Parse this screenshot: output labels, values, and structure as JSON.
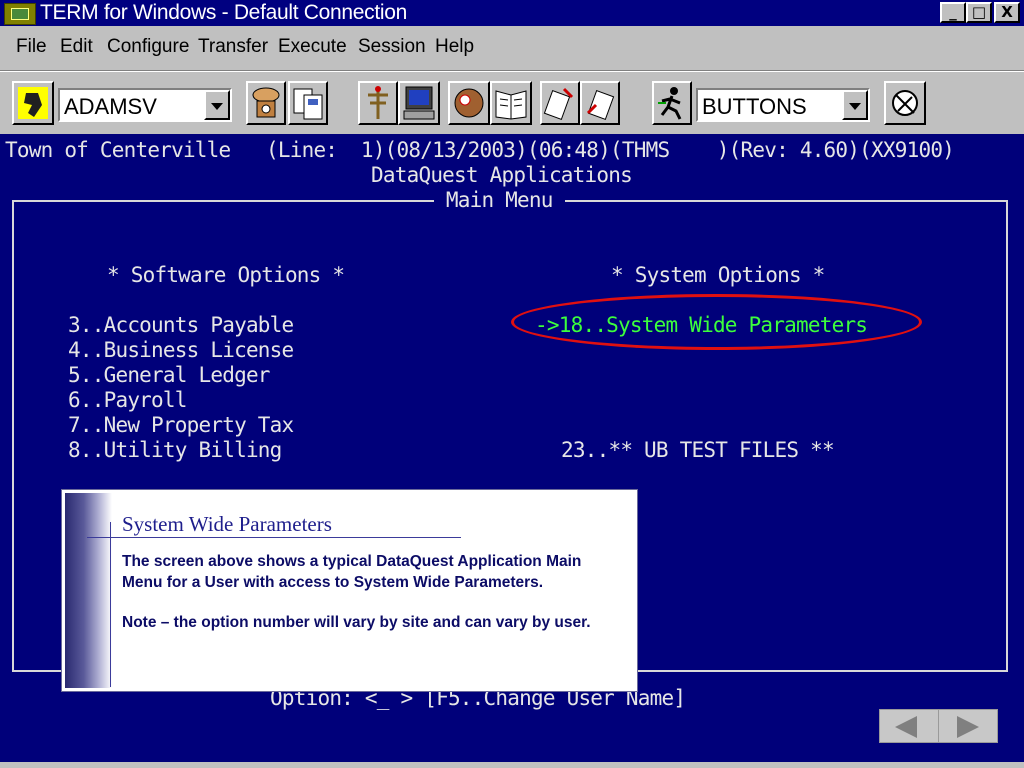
{
  "window": {
    "title": "TERM for Windows - Default Connection",
    "controls": {
      "minimize": "_",
      "maximize": "□",
      "close": "X"
    }
  },
  "menubar": {
    "items": [
      {
        "label": "File"
      },
      {
        "label": "Edit"
      },
      {
        "label": "Configure"
      },
      {
        "label": "Transfer"
      },
      {
        "label": "Execute"
      },
      {
        "label": "Session"
      },
      {
        "label": "Help"
      }
    ]
  },
  "toolbar": {
    "connection_combo": {
      "value": "ADAMSV"
    },
    "buttons_combo": {
      "value": "BUTTONS"
    },
    "icons": [
      "connect-icon",
      "phone-icon",
      "copy-icon",
      "antenna-icon",
      "computer-icon",
      "baseball-glove-icon",
      "book-icon",
      "send-file-icon",
      "receive-file-icon",
      "run-icon",
      "settings-icon"
    ]
  },
  "terminal": {
    "status_line": "Town of Centerville   (Line:  1)(08/13/2003)(06:48)(THMS    )(Rev: 4.60)(XX9100)",
    "app_title": "DataQuest Applications",
    "menu_title": " Main Menu ",
    "software_header": "* Software Options *",
    "system_header": "* System Options *",
    "software_options": [
      "3..Accounts Payable",
      "4..Business License",
      "5..General Ledger",
      "6..Payroll",
      "7..New Property Tax",
      "8..Utility Billing"
    ],
    "system_options": [
      {
        "text": "->18..System Wide Parameters",
        "highlighted": true
      },
      {
        "text": "23..** UB TEST FILES **"
      }
    ],
    "prompt": "Option: <_ > [F5..Change User Name]",
    "colors": {
      "background": "#00007a",
      "text": "#e6e6e6",
      "selected": "#3cff3c",
      "circle": "#e01010"
    }
  },
  "callout": {
    "title": "System Wide Parameters",
    "paragraphs": [
      "The screen above shows a typical DataQuest Application Main Menu for a User with access to System Wide Parameters.",
      "Note – the option number will vary by site and can vary by user."
    ]
  },
  "nav": {
    "previous_icon": "left-arrow-icon",
    "next_icon": "right-arrow-icon"
  }
}
